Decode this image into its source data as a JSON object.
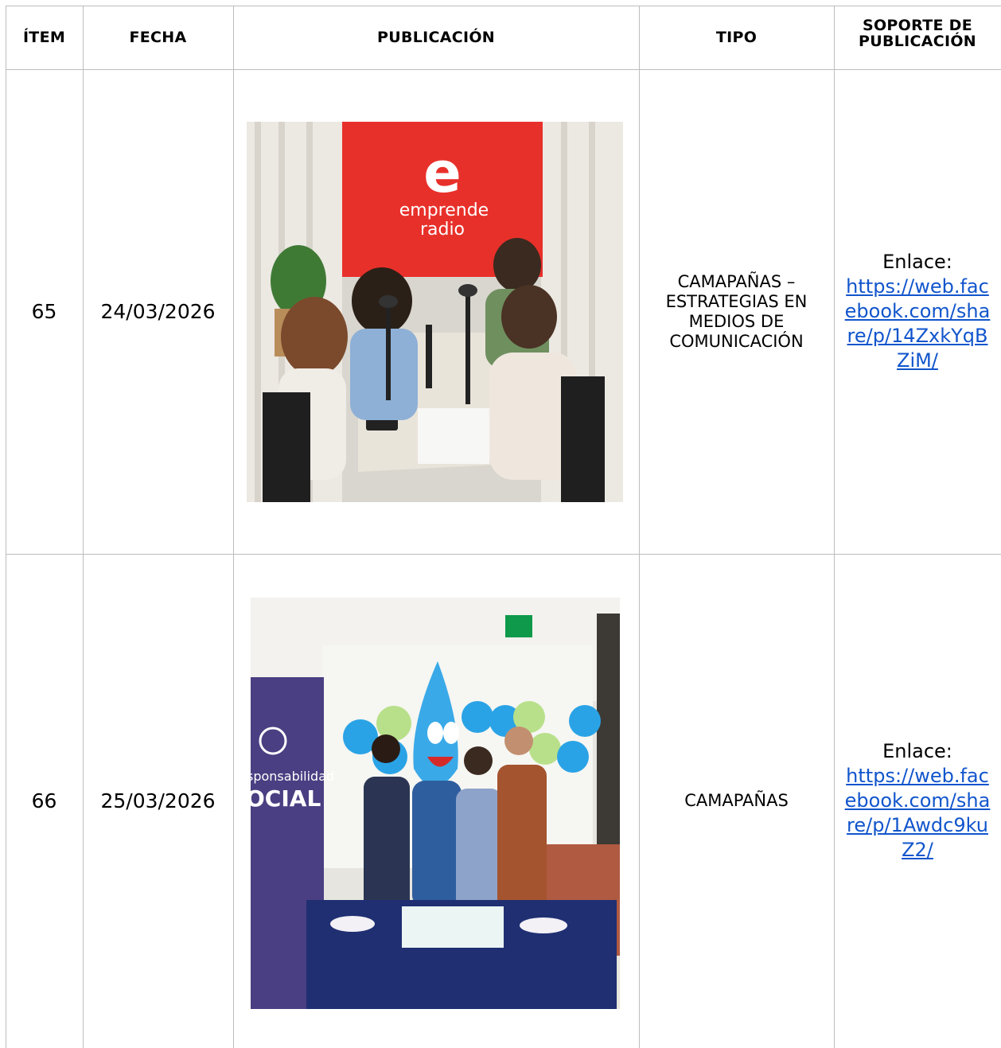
{
  "headers": {
    "item": "ÍTEM",
    "fecha": "FECHA",
    "publicacion": "PUBLICACIÓN",
    "tipo": "TIPO",
    "soporte": "SOPORTE DE PUBLICACIÓN"
  },
  "rows": [
    {
      "item": "65",
      "fecha": "24/03/2026",
      "tipo": "CAMAPAÑAS – ESTRATEGIAS EN MEDIOS DE COMUNICACIÓN",
      "soporte_label": "Enlace:",
      "soporte_url": "https://web.facebook.com/share/p/14ZxkYqBZiM/",
      "photo_text": {
        "brand_line1": "emprende",
        "brand_line2": "radio"
      }
    },
    {
      "item": "66",
      "fecha": "25/03/2026",
      "tipo": "CAMAPAÑAS",
      "soporte_label": "Enlace:",
      "soporte_url": "https://web.facebook.com/share/p/1Awdc9kuZ2/",
      "photo_text": {
        "banner_line1": "sponsabilidad",
        "banner_line2": "OCIAL"
      }
    }
  ],
  "colors": {
    "grid": "#bdbdbd",
    "link": "#1155cc",
    "radio_red": "#e8302a",
    "banner_purple": "#4a3f82",
    "tablecloth": "#1f2f72",
    "balloon_blue": "#2aa3e6",
    "balloon_green": "#b8e08a"
  }
}
